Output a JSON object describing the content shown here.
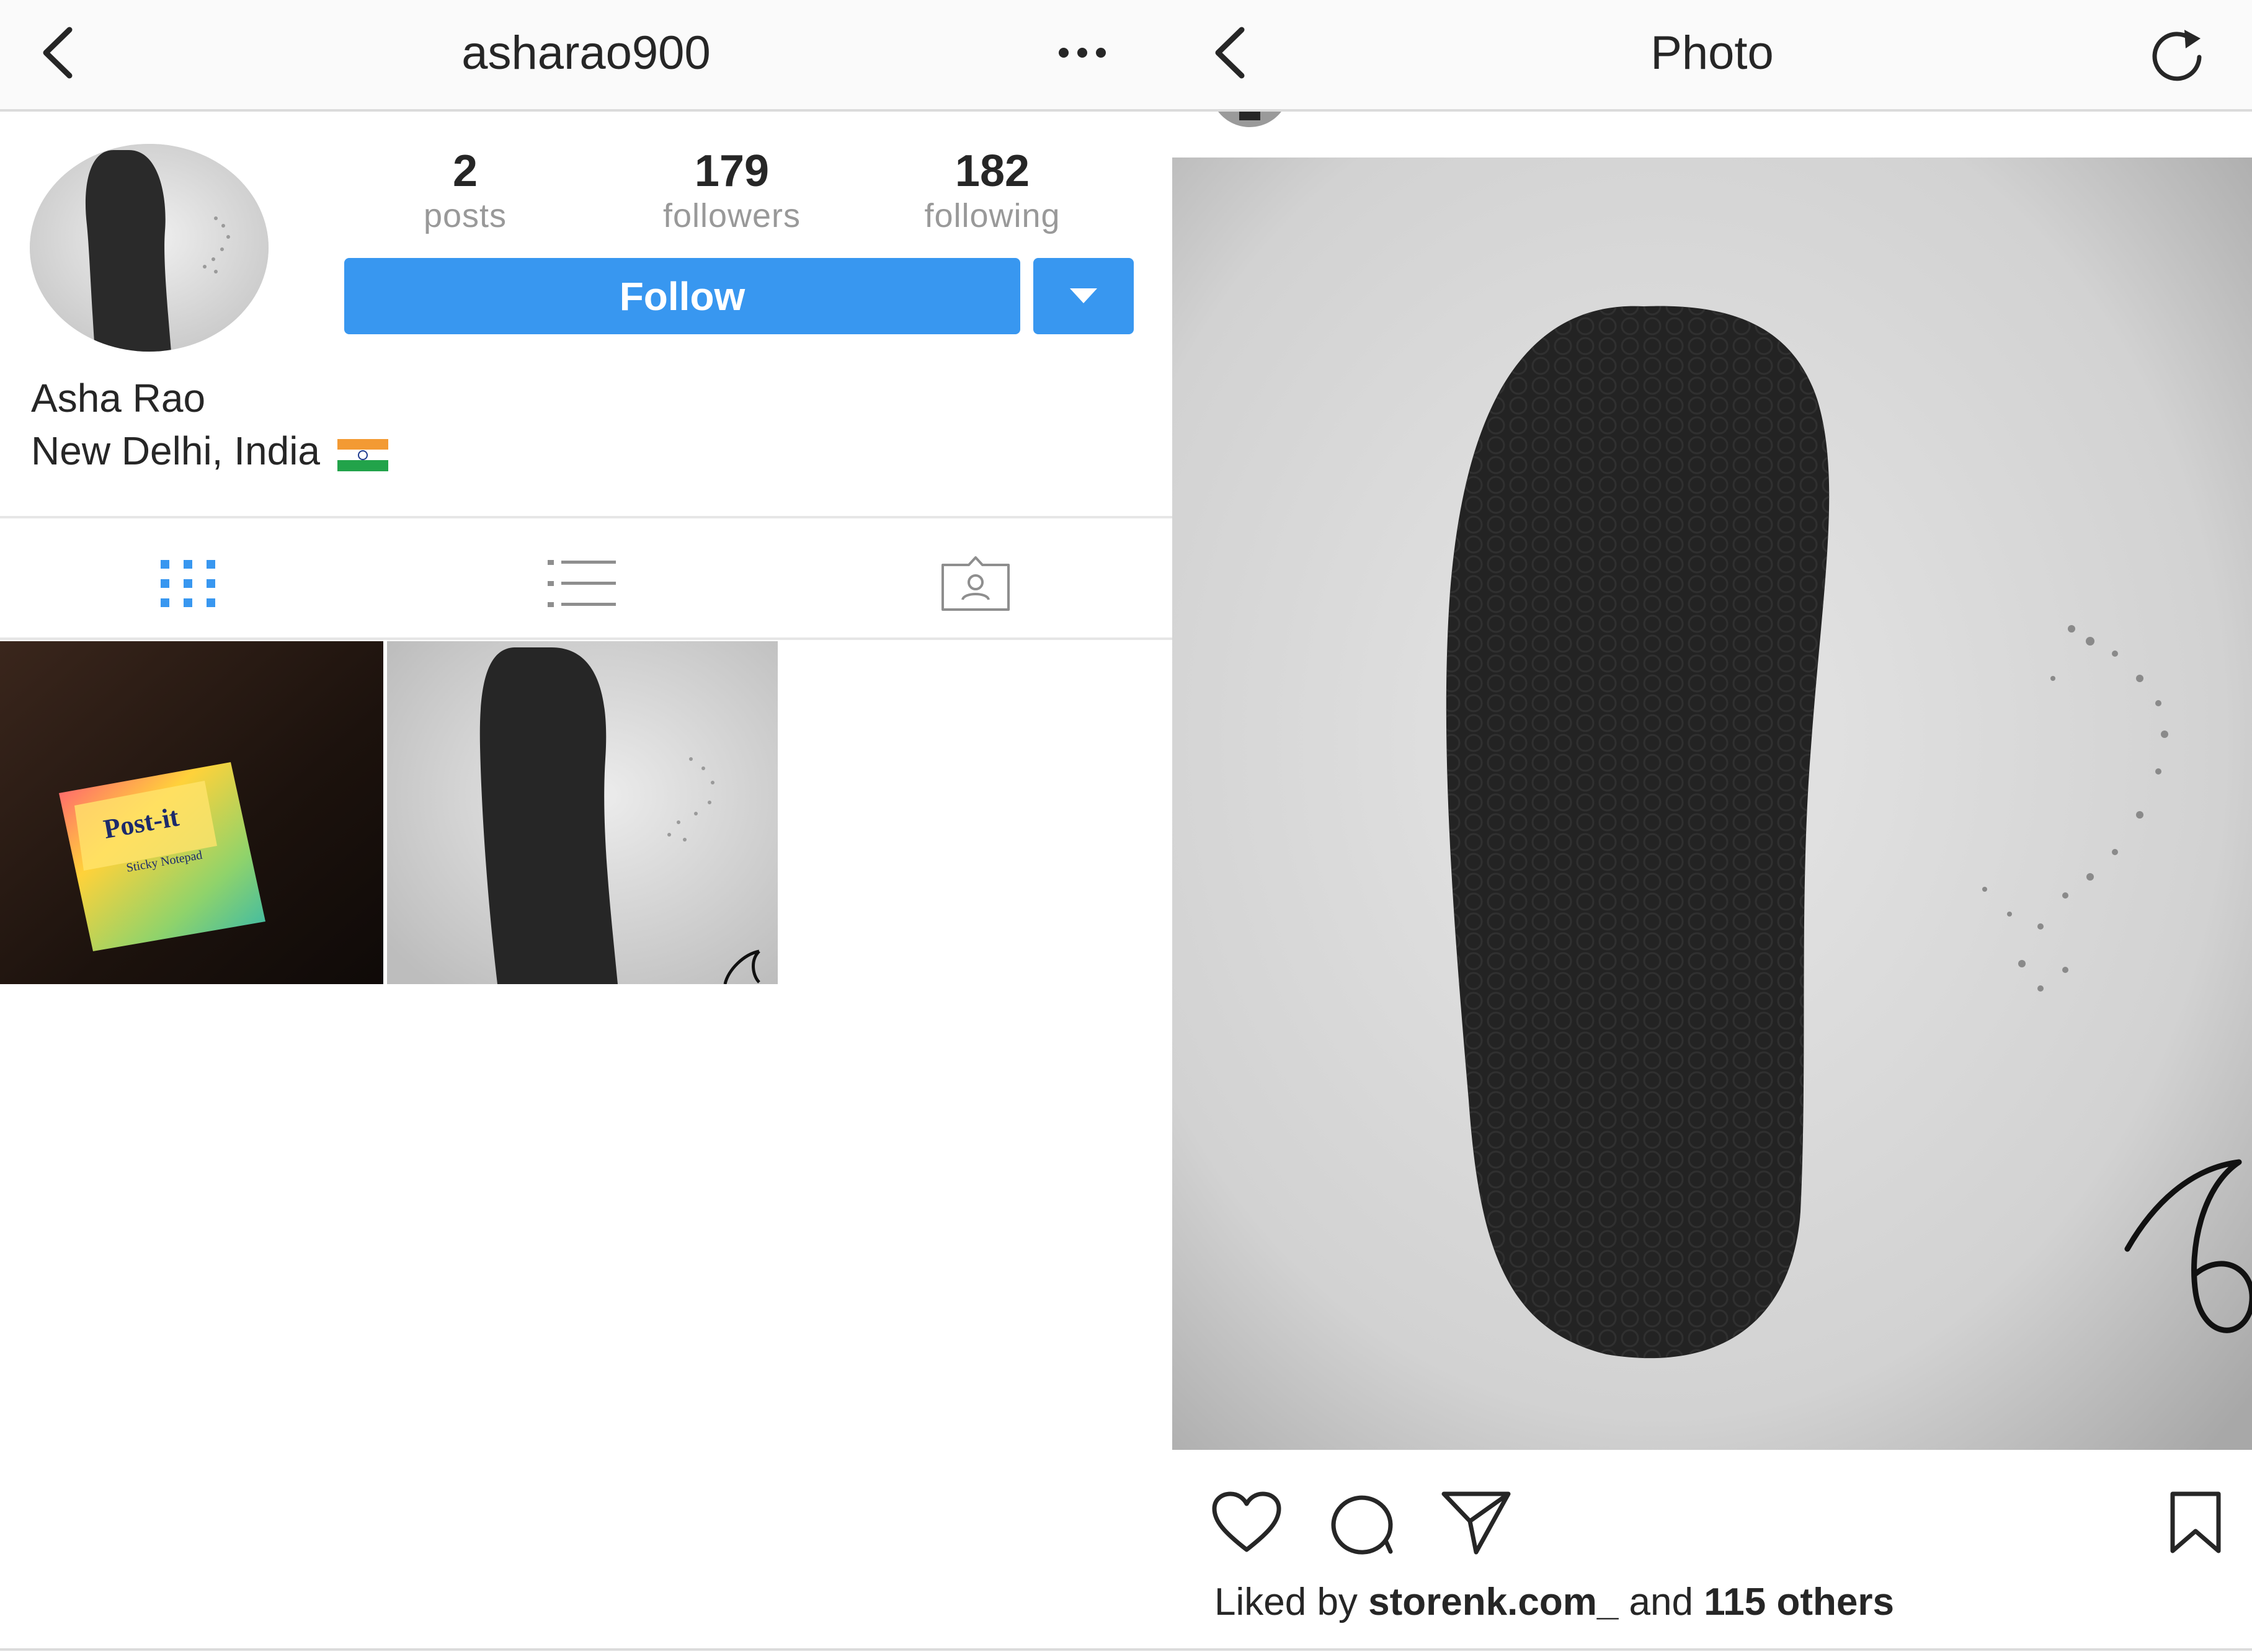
{
  "profile_screen": {
    "header": {
      "username": "asharao900",
      "back_icon": "chevron-left-icon",
      "more_icon": "more-horizontal-icon"
    },
    "stats": [
      {
        "value": "2",
        "label": "posts"
      },
      {
        "value": "179",
        "label": "followers"
      },
      {
        "value": "182",
        "label": "following"
      }
    ],
    "follow_label": "Follow",
    "dropdown_icon": "caret-down-icon",
    "full_name": "Asha Rao",
    "bio": "New Delhi, India",
    "bio_emoji": "india-flag-icon",
    "tabs": [
      {
        "icon": "grid-icon",
        "active": true
      },
      {
        "icon": "list-icon",
        "active": false
      },
      {
        "icon": "tagged-person-icon",
        "active": false
      }
    ],
    "post_thumbnails": [
      {
        "icon": "sticky-note-photo"
      },
      {
        "icon": "sandal-photo"
      }
    ],
    "colors": {
      "accent": "#3897f0",
      "muted": "#999999",
      "text": "#262626"
    }
  },
  "photo_screen": {
    "header": {
      "title": "Photo",
      "back_icon": "chevron-left-icon",
      "refresh_icon": "refresh-icon"
    },
    "actions": [
      {
        "icon": "heart-icon"
      },
      {
        "icon": "comment-icon"
      },
      {
        "icon": "send-icon"
      },
      {
        "icon": "bookmark-icon"
      }
    ],
    "likes": {
      "prefix": "Liked by ",
      "user": "storenk.com_",
      "middle": " and ",
      "count": "115 others"
    }
  }
}
